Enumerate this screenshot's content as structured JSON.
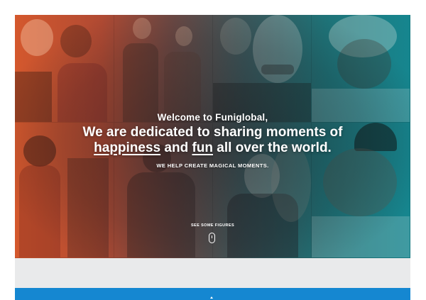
{
  "hero": {
    "welcome": "Welcome to Funiglobal,",
    "headline_prefix": "We are dedicated to sharing moments of",
    "headline_word1": "happiness",
    "headline_and": " and ",
    "headline_word2": "fun",
    "headline_suffix": " all over the world.",
    "subtitle": "WE HELP CREATE MAGICAL MOMENTS.",
    "scroll_label": "SEE SOME FIGURES"
  },
  "colors": {
    "overlay_left": "#d4582d",
    "overlay_right": "#16868f",
    "gray_band": "#e9eaeb",
    "blue_bar": "#1587d1"
  }
}
